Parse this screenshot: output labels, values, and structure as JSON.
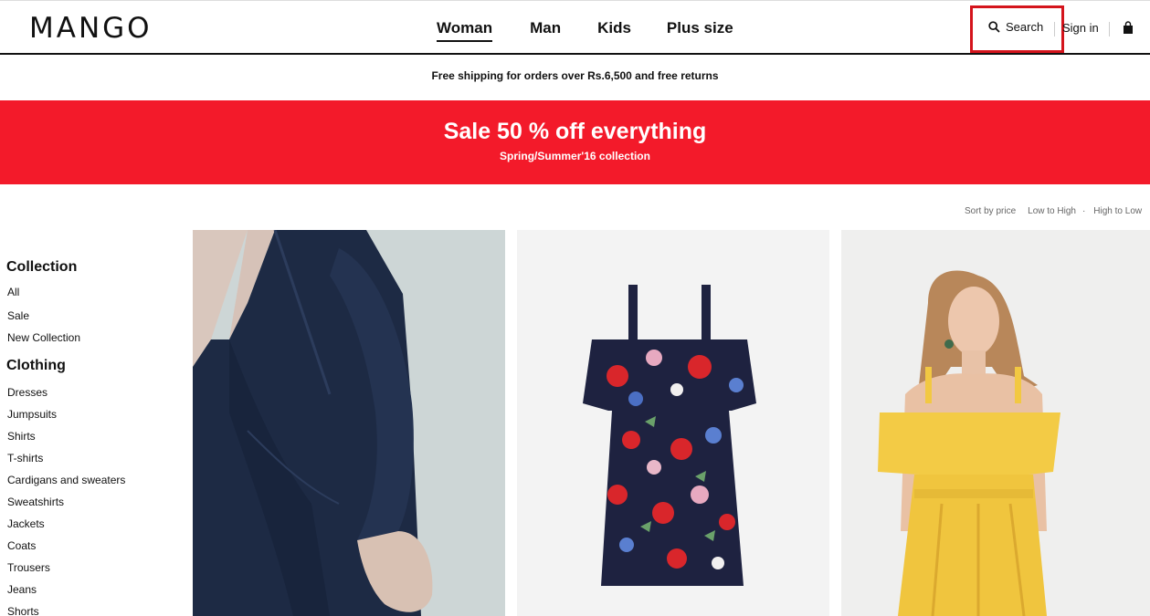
{
  "header": {
    "logo": "MANGO",
    "nav": [
      "Woman",
      "Man",
      "Kids",
      "Plus size"
    ],
    "search_label": "Search",
    "signin_label": "Sign in"
  },
  "shipping_notice": "Free shipping for orders over Rs.6,500 and free returns",
  "sale_banner": {
    "title": "Sale 50 % off everything",
    "subtitle": "Spring/Summer'16 collection",
    "color": "#f31a2a"
  },
  "sort": {
    "label": "Sort by price",
    "low_to_high": "Low to High",
    "separator": "·",
    "high_to_low": "High to Low"
  },
  "sidebar": {
    "collection_heading": "Collection",
    "collection_items": [
      "All",
      "Sale",
      "New Collection"
    ],
    "clothing_heading": "Clothing",
    "clothing_items": [
      "Dresses",
      "Jumpsuits",
      "Shirts",
      "T-shirts",
      "Cardigans and sweaters",
      "Sweatshirts",
      "Jackets",
      "Coats",
      "Trousers",
      "Jeans",
      "Shorts"
    ]
  },
  "products": [
    {
      "image": "navy-wrap-dress-photo"
    },
    {
      "image": "floral-off-shoulder-dress-photo"
    },
    {
      "image": "yellow-off-shoulder-dress-photo"
    }
  ],
  "colors": {
    "accent_red": "#d4141c",
    "text": "#111111"
  }
}
